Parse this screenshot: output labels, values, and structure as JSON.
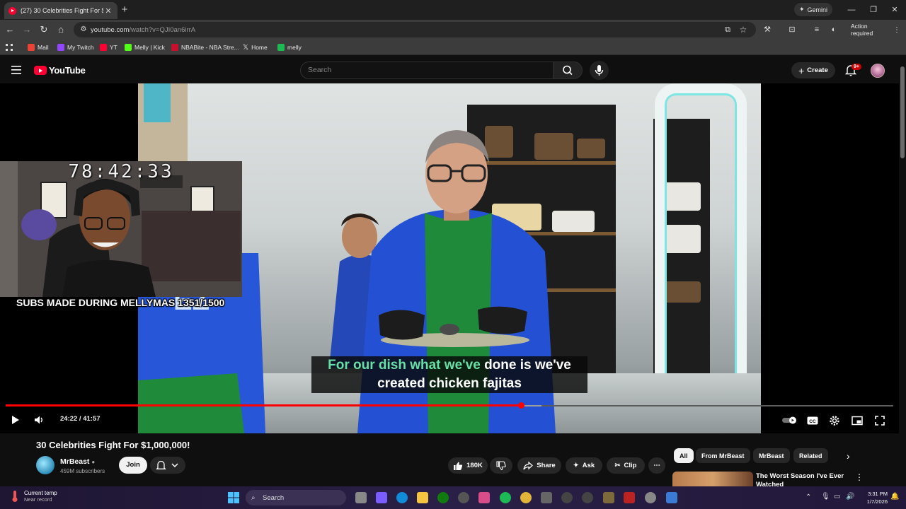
{
  "browser": {
    "tab_title": "(27) 30 Celebrities Fight For $1,0...",
    "new_tab": "+",
    "gemini_label": "Gemini",
    "url_host": "youtube.com",
    "url_path": "/watch?v=QJI0an6irrA",
    "action_required": "Action required",
    "bookmarks": [
      {
        "label": "Mail",
        "color": "#ea4335"
      },
      {
        "label": "My Twitch",
        "color": "#9146ff"
      },
      {
        "label": "YT",
        "color": "#ff0033"
      },
      {
        "label": "Melly | Kick",
        "color": "#53fc18"
      },
      {
        "label": "NBABite - NBA Stre...",
        "color": "#c8102e"
      },
      {
        "label": "Home",
        "color": "#ffffff"
      },
      {
        "label": "melly",
        "color": "#1db954"
      }
    ]
  },
  "youtube": {
    "logo_text": "YouTube",
    "search_placeholder": "Search",
    "create_label": "Create",
    "notification_badge": "9+"
  },
  "overlay": {
    "timer": "78:42:33",
    "subs_text": "SUBS MADE DURING MELLYMAS 1351/1500"
  },
  "player": {
    "caption_highlight": "For our dish what we've",
    "caption_line1_rest": " done is we've",
    "caption_line2": "created chicken fajitas",
    "current_time": "24:22",
    "duration": "41:57",
    "time_display": "24:22 / 41:57",
    "progress_fraction": 0.5808
  },
  "video": {
    "title": "30 Celebrities Fight For $1,000,000!",
    "channel": "MrBeast",
    "subscribers": "459M subscribers",
    "join_label": "Join",
    "likes": "180K",
    "share_label": "Share",
    "ask_label": "Ask",
    "clip_label": "Clip"
  },
  "chips": [
    "All",
    "From MrBeast",
    "MrBeast",
    "Related"
  ],
  "recommendation": {
    "title": "The Worst Season I've Ever Watched"
  },
  "taskbar": {
    "weather_title": "Current temp",
    "weather_sub": "Near record",
    "search_label": "Search",
    "time": "3:31 PM",
    "date": "1/7/2026"
  }
}
